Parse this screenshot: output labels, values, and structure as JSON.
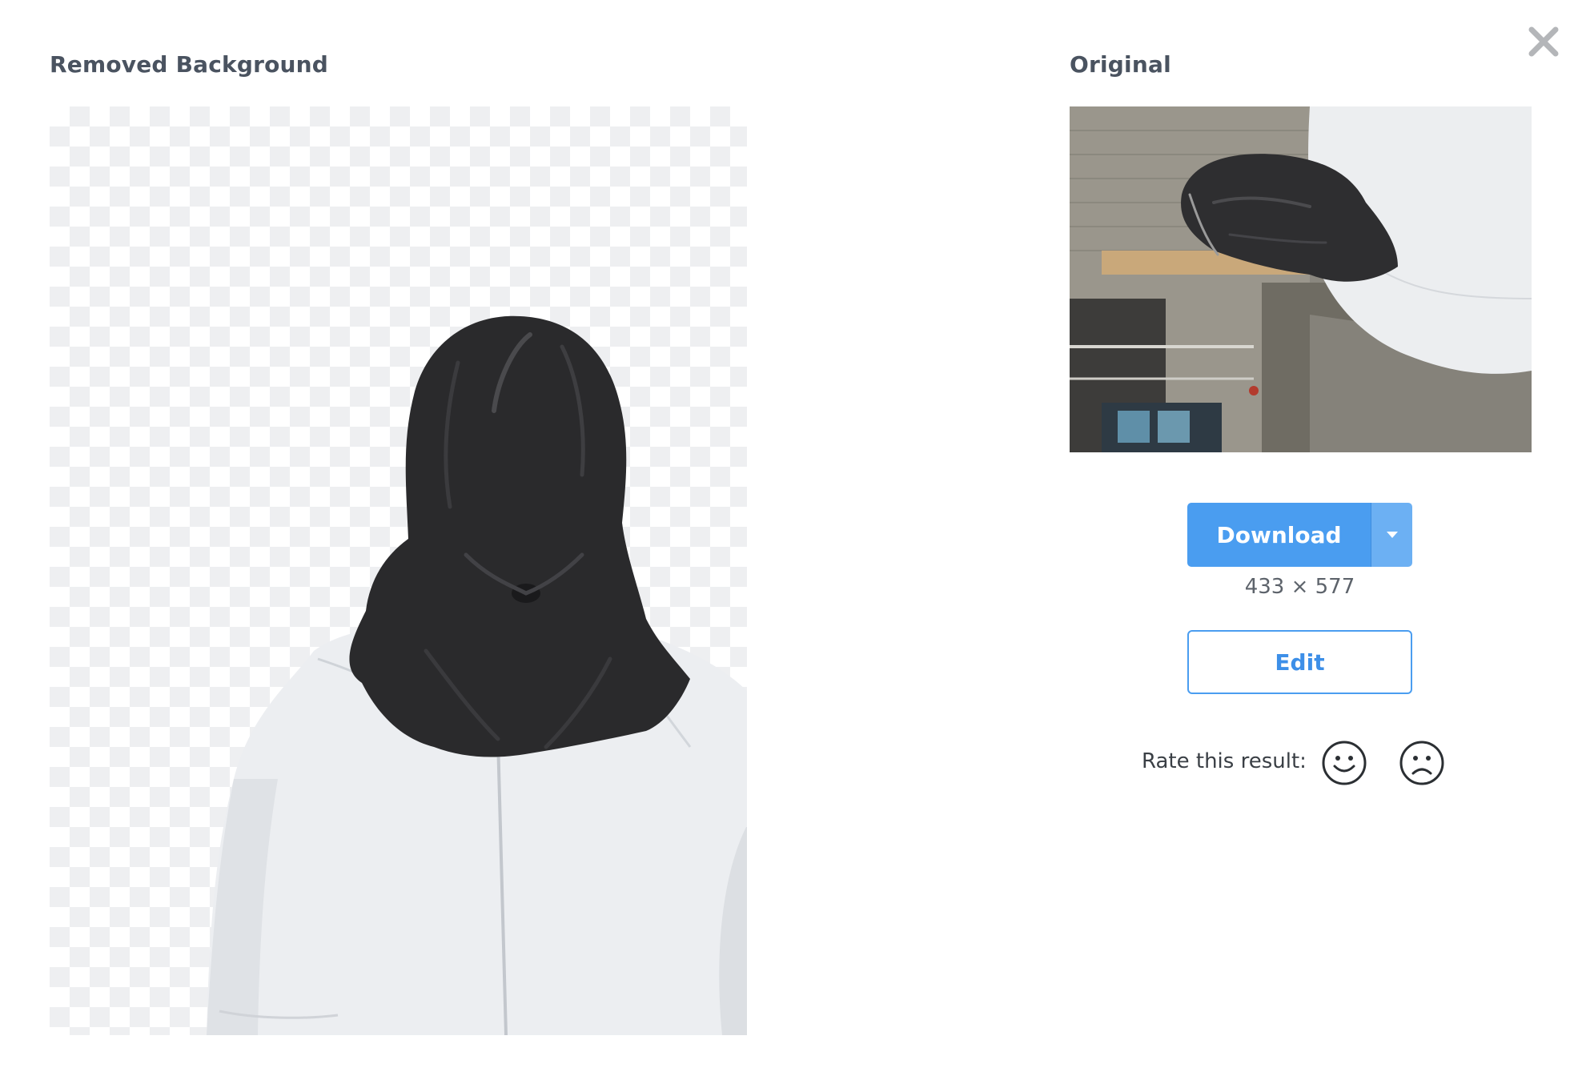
{
  "dialog": {
    "removed_title": "Removed Background",
    "original_title": "Original",
    "close_icon": "close-icon"
  },
  "actions": {
    "download_label": "Download",
    "download_caret_icon": "caret-down-icon",
    "dimensions": "433 × 577",
    "edit_label": "Edit"
  },
  "rating": {
    "label": "Rate this result:",
    "positive_icon": "smiley-face-icon",
    "negative_icon": "frown-face-icon"
  },
  "colors": {
    "accent": "#4a9df0",
    "accent_light": "#6cb0f3",
    "title_text": "#4a5360",
    "checker": "#eeeff1"
  }
}
